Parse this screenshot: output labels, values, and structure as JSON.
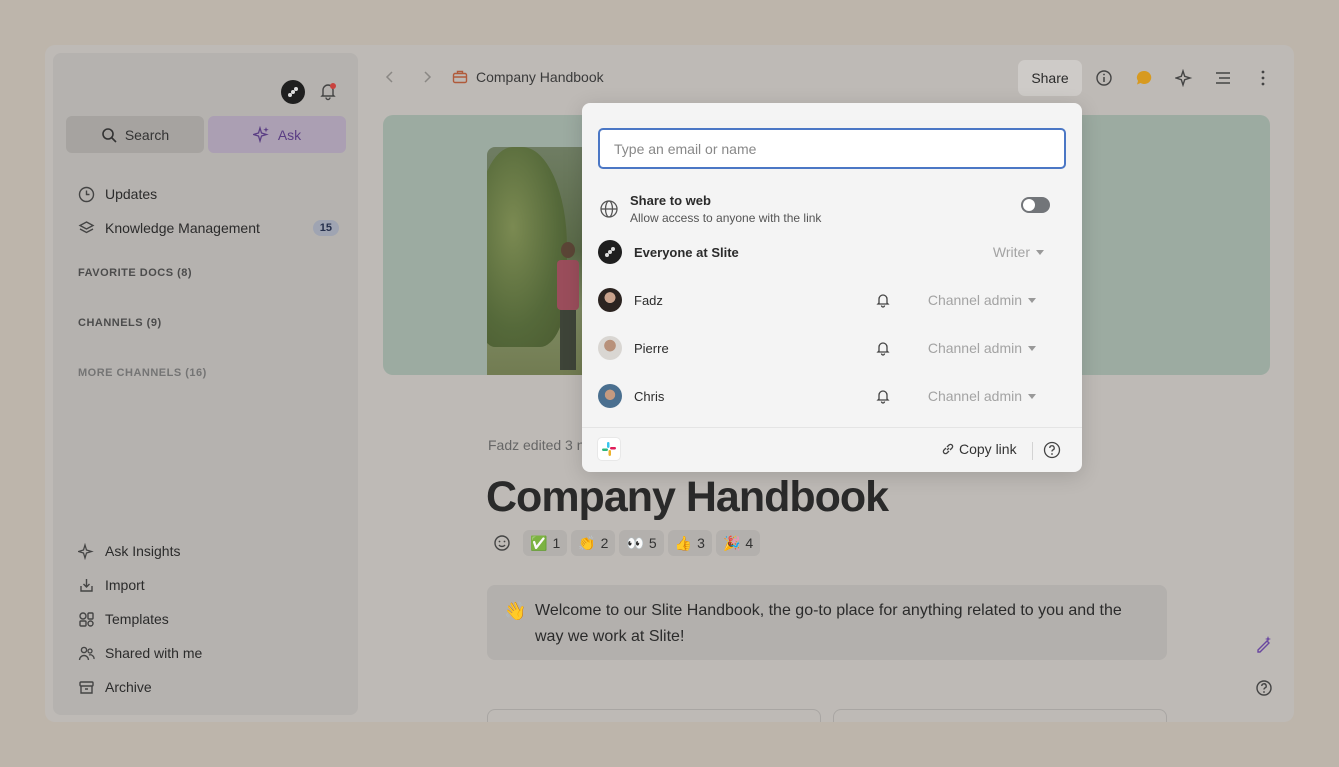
{
  "sidebar": {
    "search_label": "Search",
    "ask_label": "Ask",
    "nav_items": [
      {
        "label": "Updates",
        "icon": "clock-icon"
      },
      {
        "label": "Knowledge Management",
        "icon": "layers-icon",
        "badge": "15"
      }
    ],
    "sections": {
      "favorites": "FAVORITE DOCS (8)",
      "channels": "CHANNELS (9)",
      "more_channels": "MORE CHANNELS (16)"
    },
    "bottom_items": [
      {
        "label": "Ask Insights",
        "icon": "sparkle-icon"
      },
      {
        "label": "Import",
        "icon": "import-icon"
      },
      {
        "label": "Templates",
        "icon": "templates-icon"
      },
      {
        "label": "Shared with me",
        "icon": "users-icon"
      },
      {
        "label": "Archive",
        "icon": "archive-icon"
      }
    ]
  },
  "topbar": {
    "breadcrumb": "Company Handbook",
    "share_label": "Share"
  },
  "document": {
    "edited_text": "Fadz edited 3 n",
    "title": "Company Handbook",
    "reactions": [
      {
        "emoji": "✅",
        "count": "1"
      },
      {
        "emoji": "👏",
        "count": "2"
      },
      {
        "emoji": "👀",
        "count": "5"
      },
      {
        "emoji": "👍",
        "count": "3"
      },
      {
        "emoji": "🎉",
        "count": "4"
      }
    ],
    "callout_emoji": "👋",
    "callout_text": "Welcome to our Slite Handbook, the go-to place for anything related to you and the way we work at Slite!"
  },
  "share_popover": {
    "input_placeholder": "Type an email or name",
    "web_title": "Share to web",
    "web_subtitle": "Allow access to anyone with the link",
    "web_enabled": false,
    "members": [
      {
        "name": "Everyone at Slite",
        "role": "Writer",
        "bold": true,
        "bell": false
      },
      {
        "name": "Fadz",
        "role": "Channel admin",
        "bold": false,
        "bell": true
      },
      {
        "name": "Pierre",
        "role": "Channel admin",
        "bold": false,
        "bell": true
      },
      {
        "name": "Chris",
        "role": "Channel admin",
        "bold": false,
        "bell": true
      }
    ],
    "copy_link_label": "Copy link"
  },
  "colors": {
    "accent_purple": "#5a3d84",
    "input_focus": "#4b77c5",
    "comment_icon": "#d79a20"
  }
}
